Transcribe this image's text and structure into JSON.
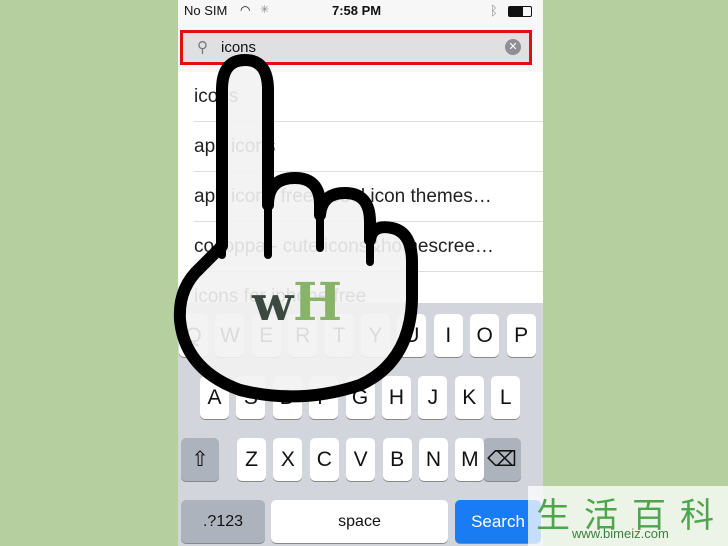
{
  "status": {
    "carrier": "No SIM",
    "time": "7:58 PM"
  },
  "search": {
    "value": "icons",
    "icon": "search-icon",
    "clear_icon": "clear-icon"
  },
  "suggestions": [
    "icons",
    "app icons",
    "app icons free - cool icon themes…",
    "cocoppa - cute icons&homescree…",
    "icons for iphone free"
  ],
  "keyboard": {
    "row1": [
      "Q",
      "W",
      "E",
      "R",
      "T",
      "Y",
      "U",
      "I",
      "O",
      "P"
    ],
    "row2": [
      "A",
      "S",
      "D",
      "F",
      "G",
      "H",
      "J",
      "K",
      "L"
    ],
    "row3": [
      "Z",
      "X",
      "C",
      "V",
      "B",
      "N",
      "M"
    ],
    "shift": "⇧",
    "delete": "⌫",
    "numbers": ".?123",
    "space": "space",
    "search": "Search"
  },
  "logo": {
    "w": "w",
    "h": "H"
  },
  "watermark": {
    "chinese": "生活百科",
    "url": "www.bimeiz.com"
  },
  "colors": {
    "highlight": "#e01010",
    "search_key": "#1a7cf5",
    "background": "#b5cf9f"
  }
}
